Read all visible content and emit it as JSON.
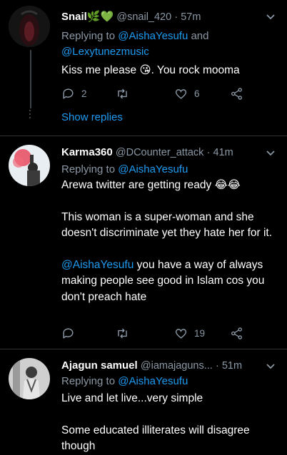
{
  "tweets": [
    {
      "name": "Snail🌿💚",
      "handle": "@snail_420",
      "time": "· 57m",
      "replying_prefix": "Replying to",
      "replying_to": [
        "@AishaYesufu",
        "@Lexytunezmusic"
      ],
      "replying_joiner": "and",
      "text": "Kiss me please 😘. You rock mooma",
      "replies": "2",
      "retweets": "",
      "likes": "6",
      "show_replies": "Show replies"
    },
    {
      "name": "Karma360",
      "handle": "@DCounter_attack",
      "time": "· 41m",
      "replying_prefix": "Replying to",
      "replying_to": [
        "@AishaYesufu"
      ],
      "para1": "Arewa twitter are getting ready 😂😂",
      "para2": "This woman is a super-woman and she doesn't discriminate yet they hate her for it.",
      "para3_mention": "@AishaYesufu",
      "para3_rest": " you have a way of always making people see good in Islam cos you don't preach hate",
      "replies": "",
      "retweets": "",
      "likes": "19"
    },
    {
      "name": "Ajagun samuel",
      "handle": "@iamajaguns...",
      "time": "· 51m",
      "replying_prefix": "Replying to",
      "replying_to": [
        "@AishaYesufu"
      ],
      "para1": "Live and let live...very simple",
      "para2": "Some educated illiterates will disagree though"
    }
  ],
  "icons": {
    "reply": "reply-icon",
    "retweet": "retweet-icon",
    "like": "heart-icon",
    "share": "share-icon",
    "more": "chevron-down-icon"
  },
  "colors": {
    "background": "#000000",
    "text": "#ffffff",
    "muted": "#8b98a5",
    "link": "#1d9bf0",
    "divider": "#2f3336"
  }
}
